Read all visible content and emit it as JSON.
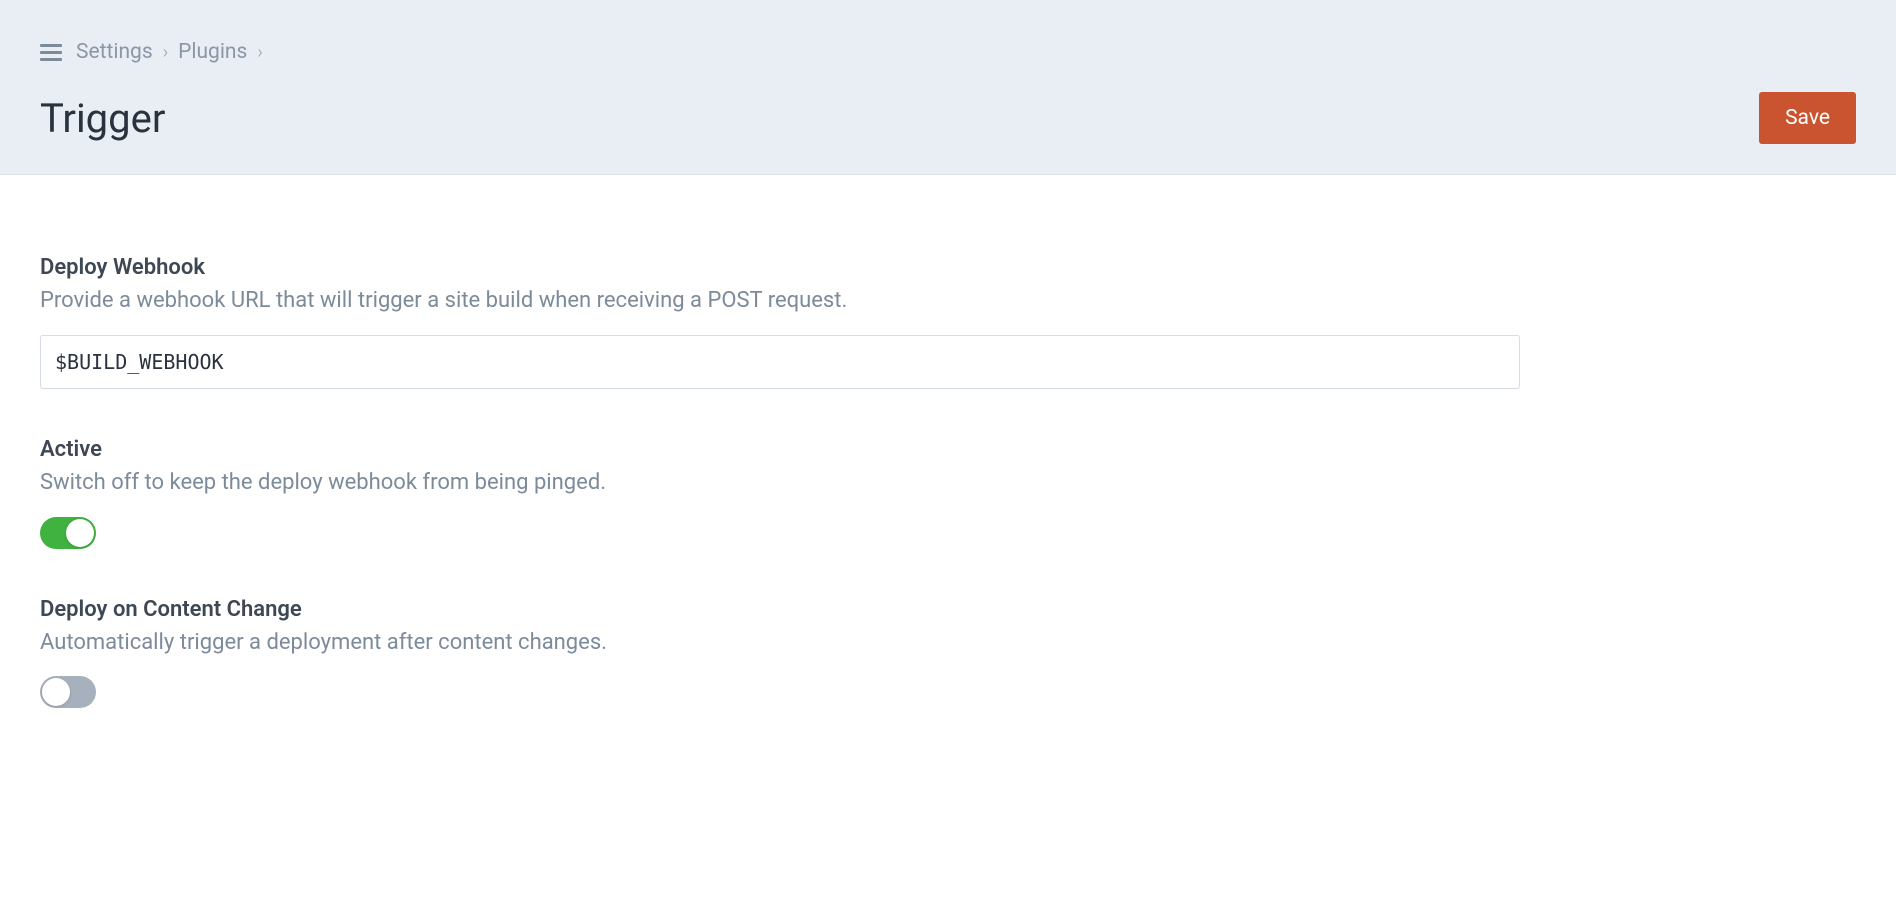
{
  "breadcrumb": {
    "items": [
      "Settings",
      "Plugins"
    ]
  },
  "page": {
    "title": "Trigger",
    "save_label": "Save"
  },
  "fields": {
    "webhook": {
      "label": "Deploy Webhook",
      "description": "Provide a webhook URL that will trigger a site build when receiving a POST request.",
      "value": "$BUILD_WEBHOOK"
    },
    "active": {
      "label": "Active",
      "description": "Switch off to keep the deploy webhook from being pinged.",
      "value": true
    },
    "deploy_on_change": {
      "label": "Deploy on Content Change",
      "description": "Automatically trigger a deployment after content changes.",
      "value": false
    }
  }
}
